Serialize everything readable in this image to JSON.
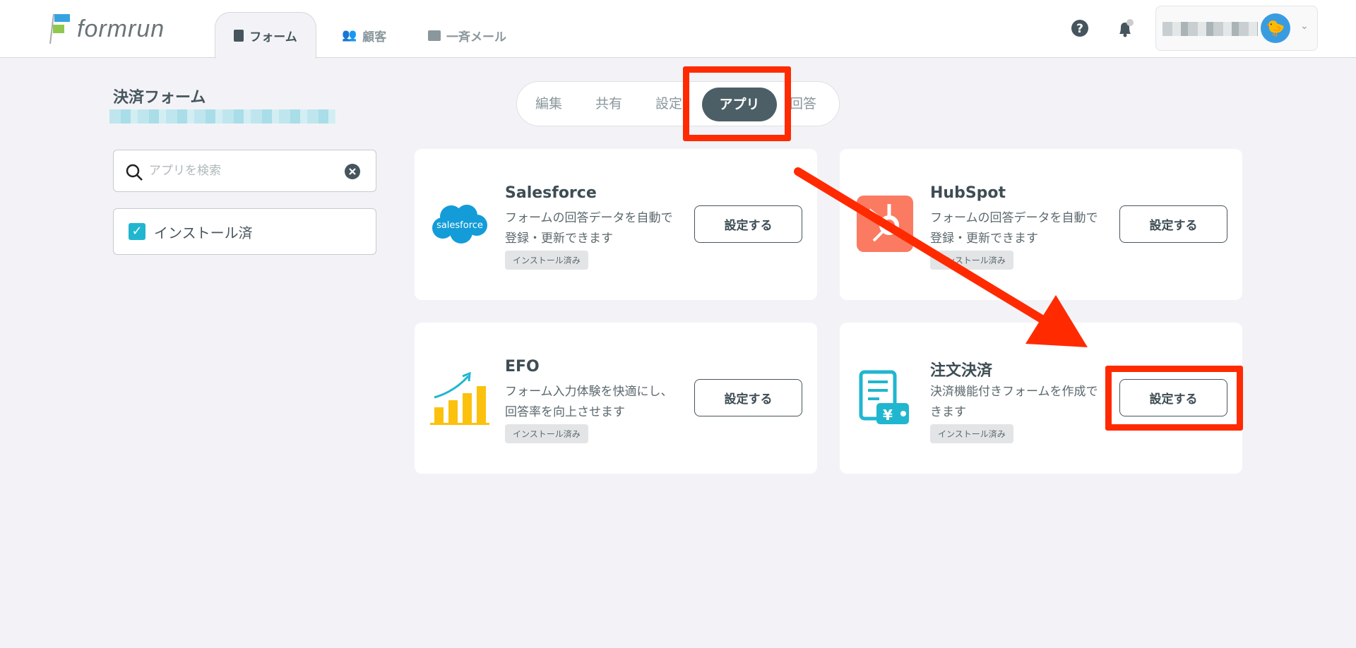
{
  "header": {
    "logo": "formrun",
    "tabs": [
      {
        "label": "フォーム",
        "icon": "form-icon"
      },
      {
        "label": "顧客",
        "icon": "customers-icon"
      },
      {
        "label": "一斉メール",
        "icon": "mail-icon"
      }
    ]
  },
  "page": {
    "title": "決済フォーム"
  },
  "segments": [
    "編集",
    "共有",
    "設定",
    "アプリ",
    "回答"
  ],
  "search": {
    "placeholder": "アプリを検索"
  },
  "filter": {
    "label": "インストール済"
  },
  "apps": [
    {
      "name": "Salesforce",
      "desc": "フォームの回答データを自動で登録・更新できます",
      "badge": "インストール済み",
      "button": "設定する",
      "logo_text": "salesforce"
    },
    {
      "name": "HubSpot",
      "desc": "フォームの回答データを自動で登録・更新できます",
      "badge": "インストール済み",
      "button": "設定する"
    },
    {
      "name": "EFO",
      "desc": "フォーム入力体験を快適にし、回答率を向上させます",
      "badge": "インストール済み",
      "button": "設定する"
    },
    {
      "name": "注文決済",
      "desc": "決済機能付きフォームを作成できます",
      "badge": "インストール済み",
      "button": "設定する"
    }
  ],
  "colors": {
    "annotation": "#ff2a00",
    "accent": "#21b6cf",
    "active_segment": "#4d5f66"
  }
}
